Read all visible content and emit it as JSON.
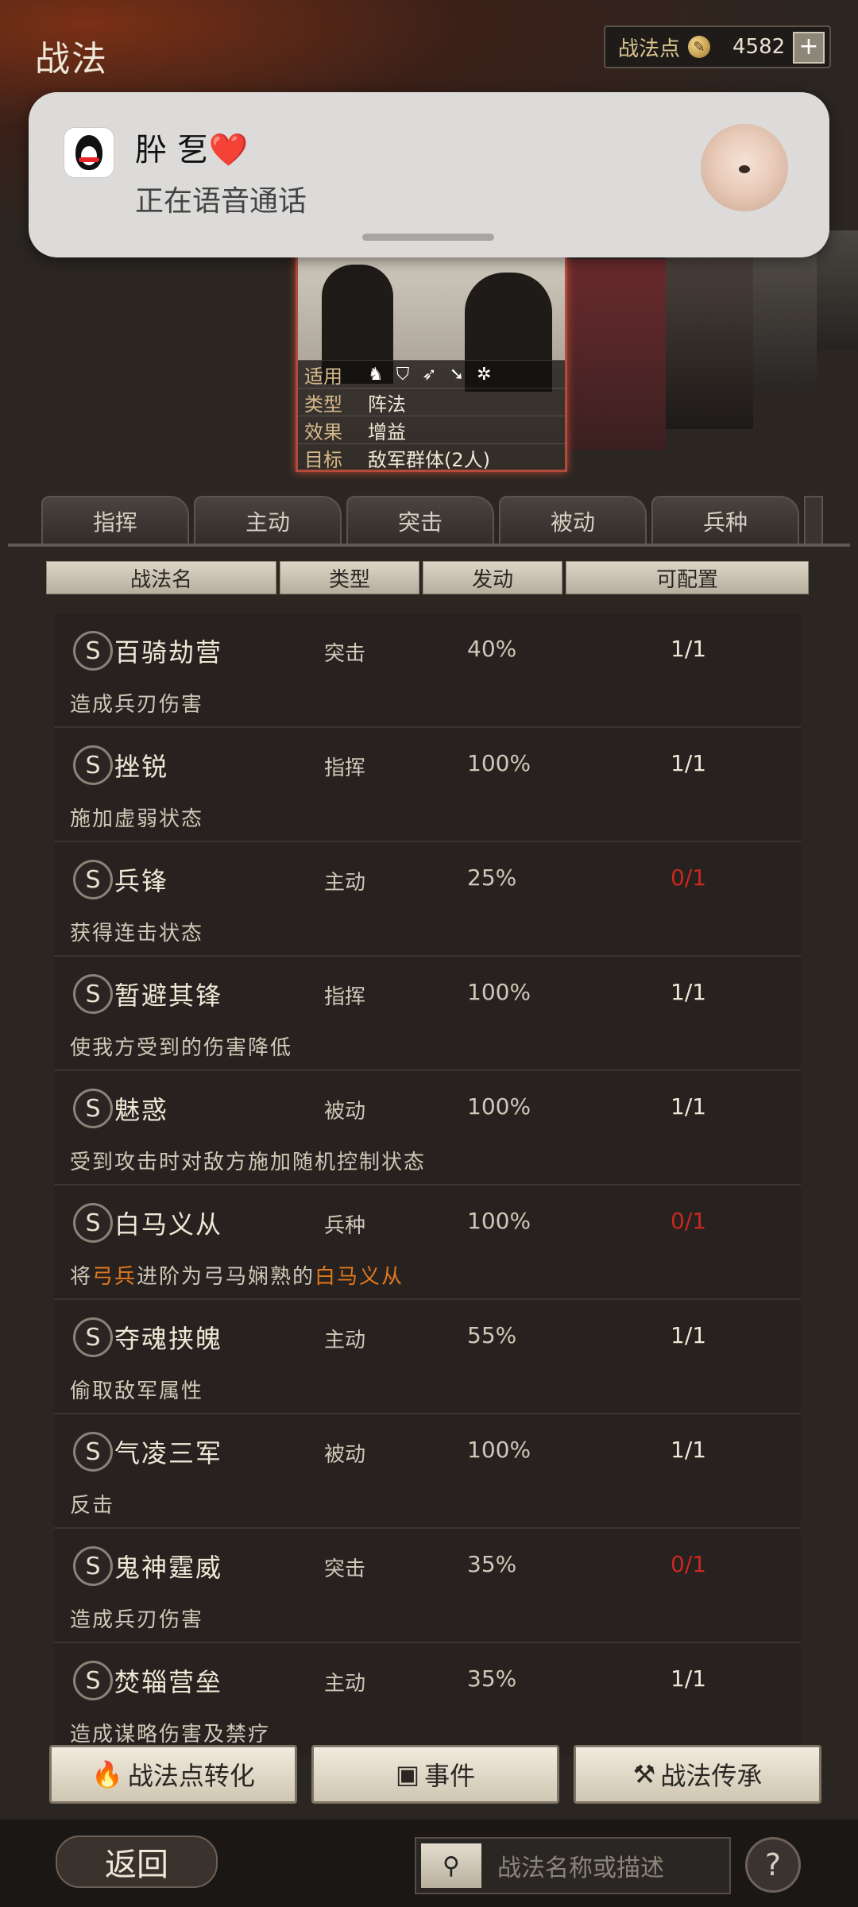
{
  "header": {
    "title": "战法",
    "points_label": "战法点",
    "points_value": "4582",
    "plus_label": "+"
  },
  "notification": {
    "app_icon": "qq-penguin-icon",
    "name": "肸 乭❤️",
    "subtitle": "正在语音通话"
  },
  "hero_card": {
    "rows": [
      {
        "key": "适用",
        "value": ""
      },
      {
        "key": "类型",
        "value": "阵法"
      },
      {
        "key": "效果",
        "value": "增益"
      },
      {
        "key": "目标",
        "value": "敌军群体(2人)"
      }
    ]
  },
  "tabs": [
    "指挥",
    "主动",
    "突击",
    "被动",
    "兵种"
  ],
  "table_headers": [
    "战法名",
    "类型",
    "发动",
    "可配置"
  ],
  "rows": [
    {
      "badge": "S",
      "name": "百骑劫营",
      "type": "突击",
      "percent": "40%",
      "config": "1/1",
      "config_red": false,
      "desc": "造成兵刃伤害"
    },
    {
      "badge": "S",
      "name": "挫锐",
      "type": "指挥",
      "percent": "100%",
      "config": "1/1",
      "config_red": false,
      "desc": "施加虚弱状态"
    },
    {
      "badge": "S",
      "name": "兵锋",
      "type": "主动",
      "percent": "25%",
      "config": "0/1",
      "config_red": true,
      "desc": "获得连击状态"
    },
    {
      "badge": "S",
      "name": "暂避其锋",
      "type": "指挥",
      "percent": "100%",
      "config": "1/1",
      "config_red": false,
      "desc": "使我方受到的伤害降低"
    },
    {
      "badge": "S",
      "name": "魅惑",
      "type": "被动",
      "percent": "100%",
      "config": "1/1",
      "config_red": false,
      "desc": "受到攻击时对敌方施加随机控制状态"
    },
    {
      "badge": "S",
      "name": "白马义从",
      "type": "兵种",
      "percent": "100%",
      "config": "0/1",
      "config_red": true,
      "desc_parts": [
        "将",
        "弓兵",
        "进阶为弓马娴熟的",
        "白马义从"
      ]
    },
    {
      "badge": "S",
      "name": "夺魂挟魄",
      "type": "主动",
      "percent": "55%",
      "config": "1/1",
      "config_red": false,
      "desc": "偷取敌军属性"
    },
    {
      "badge": "S",
      "name": "气凌三军",
      "type": "被动",
      "percent": "100%",
      "config": "1/1",
      "config_red": false,
      "desc": "反击"
    },
    {
      "badge": "S",
      "name": "鬼神霆威",
      "type": "突击",
      "percent": "35%",
      "config": "0/1",
      "config_red": true,
      "desc": "造成兵刃伤害"
    },
    {
      "badge": "S",
      "name": "焚辎营垒",
      "type": "主动",
      "percent": "35%",
      "config": "1/1",
      "config_red": false,
      "desc": "造成谋略伤害及禁疗"
    }
  ],
  "buttons": {
    "convert": "战法点转化",
    "event": "事件",
    "inherit": "战法传承"
  },
  "footer": {
    "back": "返回",
    "search_placeholder": "战法名称或描述",
    "help": "?"
  },
  "colors": {
    "accent_red": "#c8281e",
    "highlight_orange": "#e0781e"
  }
}
